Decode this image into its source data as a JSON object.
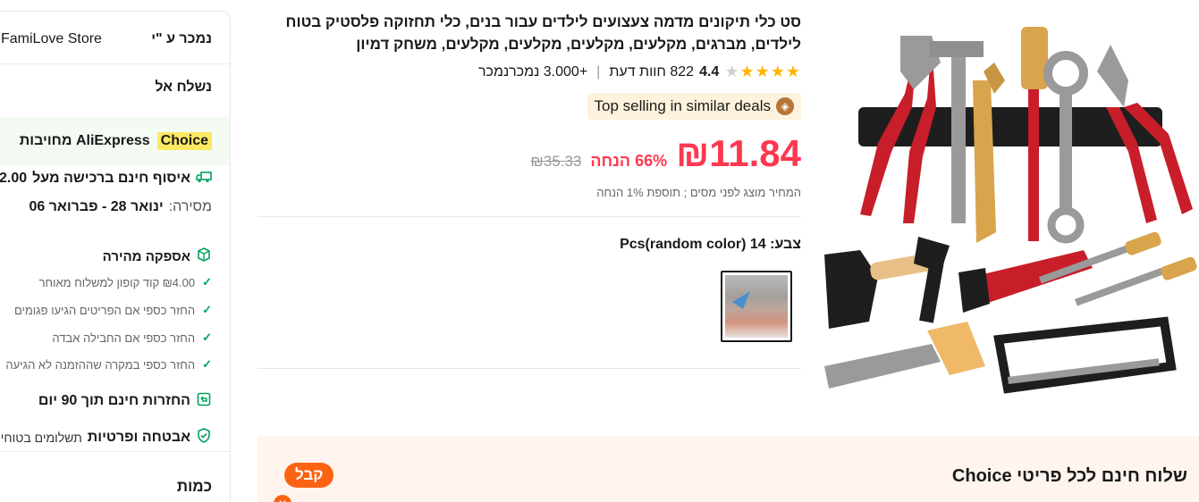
{
  "sidebar": {
    "sold_by_label": "נמכר ע \"י",
    "store_name": "FamiLove Store",
    "ship_to_label": "נשלח אל",
    "choice_badge": "Choice",
    "choice_text": "AliExpress מחויבות",
    "free_pickup": "איסוף חינם ברכישה מעל",
    "free_pickup_amount": "2.00",
    "delivery_label": "מסירה:",
    "delivery_value": "ינואר 28 - פברואר 06",
    "fast_delivery": "אספקה מהירה",
    "fast_items": [
      "₪4.00 קוד קופון למשלוח מאוחר",
      "החזר כספי אם הפריטים הגיעו פגומים",
      "החזר כספי אם החבילה אבדה",
      "החזר כספי במקרה שההזמנה לא הגיעה"
    ],
    "returns": "החזרות חינם תוך 90 יום",
    "safety_bold": "אבטחה ופרטיות",
    "safety_sub": "תשלומים בטוחים",
    "quantity_label": "כמות"
  },
  "product": {
    "title": "סט כלי תיקונים מדמה צעצועים לילדים עבור בנים, כלי תחזוקה פלסטיק בטוח לילדים, מברגים, מקלעים, מקלעים, מקלעים, מקלעים, משחק דמיון",
    "rating": "4.4",
    "stars_full": 4,
    "reviews": "822 חוות דעת",
    "sold": "+3.000 נמכרנמכר",
    "top_selling": "Top selling in similar deals",
    "price": "₪11.84",
    "discount": "66% הנחה",
    "original_price": "₪35.33",
    "tax_note": "המחיר מוצג לפני מסים ; תוספת 1% הנחה",
    "color_label": "צבע: 14 Pcs(random color)"
  },
  "banner": {
    "title": "שלוח חינם לכל פריטי Choice",
    "button": "קבל"
  },
  "colors": {
    "price_red": "#fd384f",
    "choice_yellow": "#fde863",
    "accent_orange": "#fb6312",
    "success_green": "#00a35a"
  }
}
